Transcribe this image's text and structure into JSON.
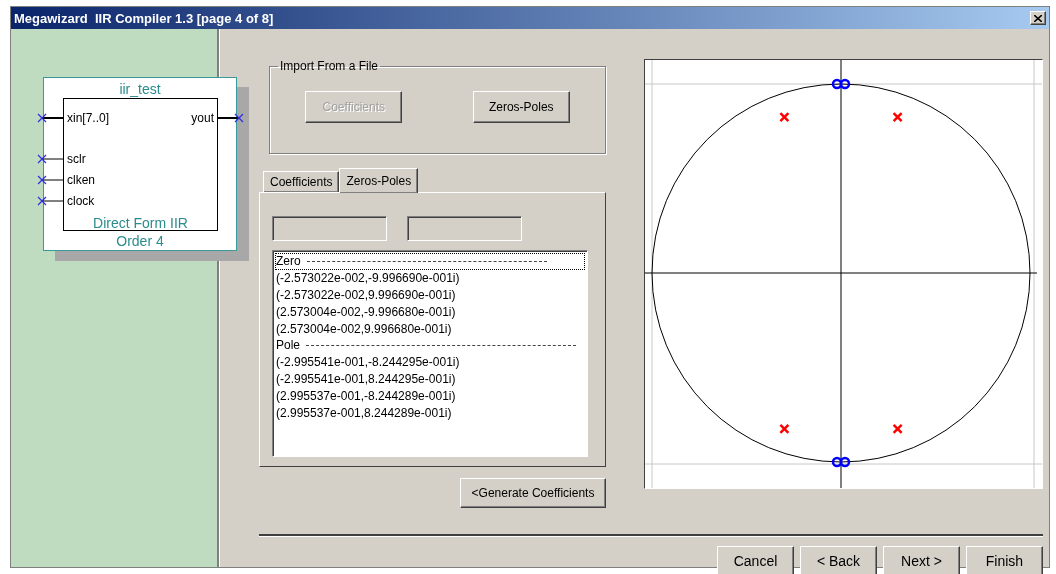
{
  "window": {
    "title": "Megawizard  IIR Compiler 1.3 [page 4 of 8]"
  },
  "symbol": {
    "name": "iir_test",
    "inputs": [
      {
        "label": "xin[7..0]",
        "kind": "bus"
      },
      {
        "label": "sclr",
        "kind": "wire"
      },
      {
        "label": "clken",
        "kind": "wire"
      },
      {
        "label": "clock",
        "kind": "wire"
      }
    ],
    "outputs": [
      {
        "label": "yout",
        "kind": "bus"
      }
    ],
    "structure": "Direct Form IIR",
    "order": "Order 4"
  },
  "import_group": {
    "title": "Import From a File",
    "buttons": [
      {
        "label": "Coefficients",
        "disabled": true
      },
      {
        "label": "Zeros-Poles",
        "disabled": false
      }
    ]
  },
  "tabs": [
    {
      "label": "Coefficients",
      "selected": false
    },
    {
      "label": "Zeros-Poles",
      "selected": true
    }
  ],
  "list": [
    {
      "kind": "header",
      "text": "Zero",
      "focused": true
    },
    {
      "kind": "value",
      "text": "(-2.573022e-002,-9.996690e-001i)",
      "focused": false
    },
    {
      "kind": "value",
      "text": "(-2.573022e-002,9.996690e-001i)",
      "focused": false
    },
    {
      "kind": "value",
      "text": "(2.573004e-002,-9.996680e-001i)",
      "focused": false
    },
    {
      "kind": "value",
      "text": "(2.573004e-002,9.996680e-001i)",
      "focused": false
    },
    {
      "kind": "header",
      "text": "Pole",
      "focused": false
    },
    {
      "kind": "value",
      "text": "(-2.995541e-001,-8.244295e-001i)",
      "focused": false
    },
    {
      "kind": "value",
      "text": "(-2.995541e-001,8.244295e-001i)",
      "focused": false
    },
    {
      "kind": "value",
      "text": "(2.995537e-001,-8.244289e-001i)",
      "focused": false
    },
    {
      "kind": "value",
      "text": "(2.995537e-001,8.244289e-001i)",
      "focused": false
    }
  ],
  "generate_button": {
    "label": "<Generate Coefficients"
  },
  "nav_buttons": [
    {
      "label": "Cancel"
    },
    {
      "label": "< Back"
    },
    {
      "label": "Next >"
    },
    {
      "label": "Finish"
    }
  ]
}
